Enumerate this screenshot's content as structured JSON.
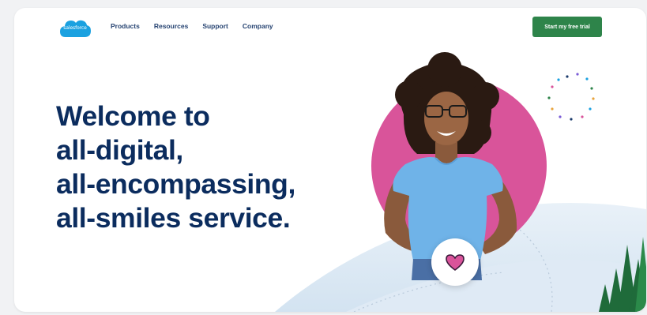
{
  "brand": {
    "logo_text": "salesforce"
  },
  "nav": {
    "items": [
      {
        "label": "Products"
      },
      {
        "label": "Resources"
      },
      {
        "label": "Support"
      },
      {
        "label": "Company"
      }
    ],
    "cta_label": "Start my free trial"
  },
  "hero": {
    "headline_lines": [
      "Welcome to",
      "all-digital,",
      "all-encompassing,",
      "all-smiles service."
    ]
  },
  "colors": {
    "brand_blue": "#1ba1e0",
    "headline_navy": "#0b2c5e",
    "cta_green": "#2e844a",
    "circle_pink": "#d9549a",
    "shirt_blue": "#6fb3e8"
  },
  "icons": {
    "logo": "salesforce-cloud-logo",
    "heart": "heart-icon",
    "dots": "confetti-dots-ring"
  }
}
